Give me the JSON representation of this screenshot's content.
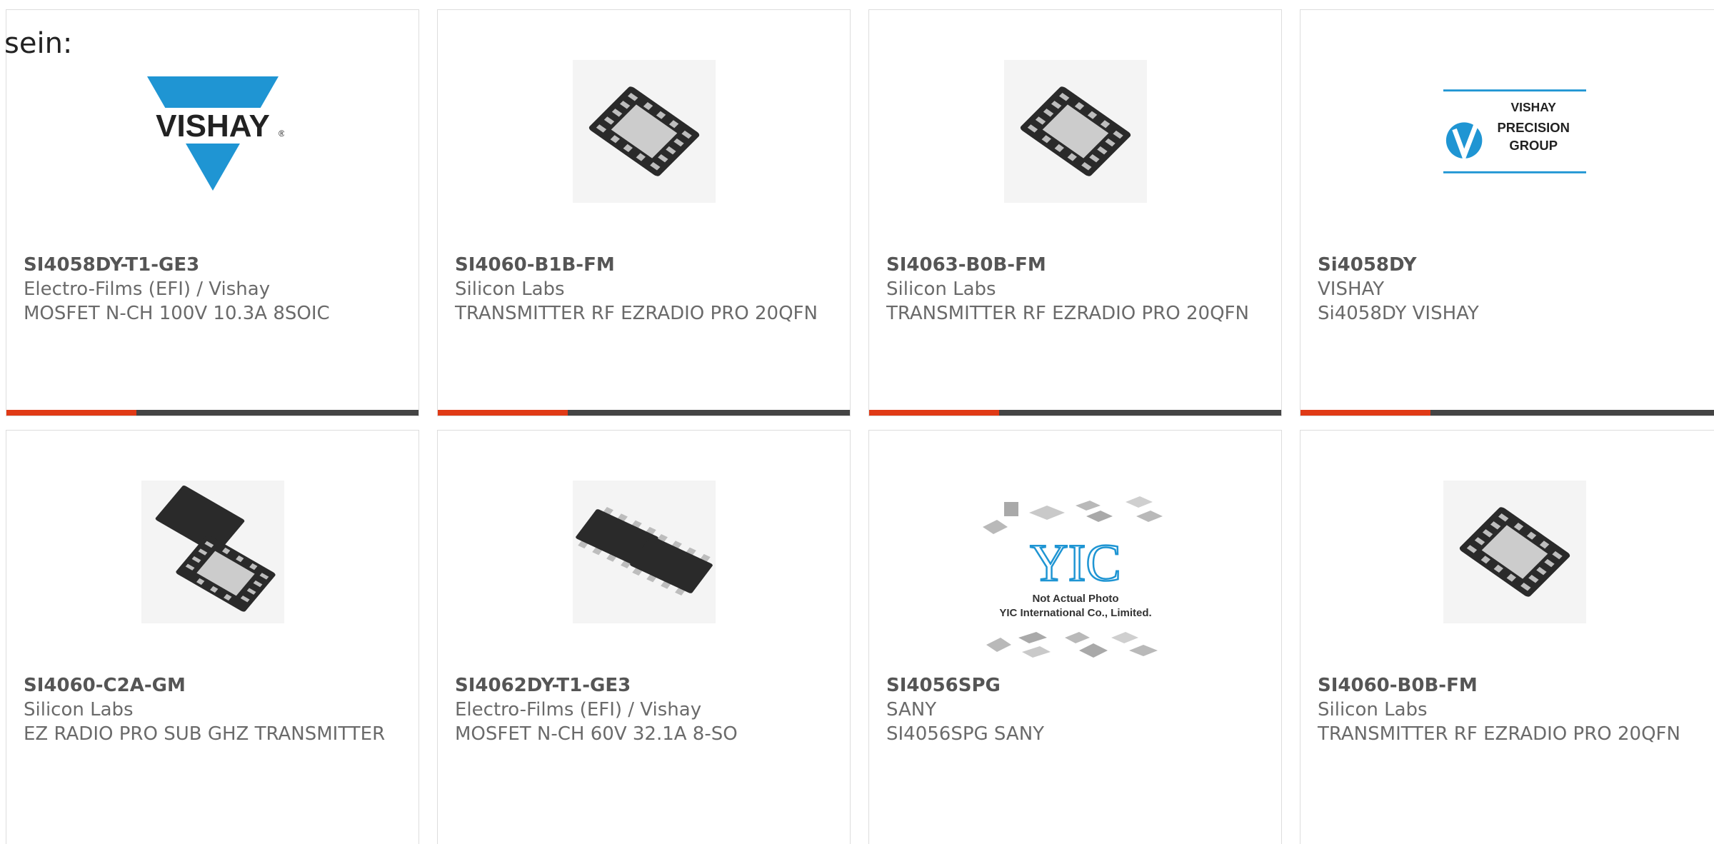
{
  "intro_text": "sein:",
  "products": [
    {
      "part_number": "SI4058DY-T1-GE3",
      "manufacturer": "Electro-Films (EFI) / Vishay",
      "description": "MOSFET N-CH 100V 10.3A 8SOIC",
      "image": "vishay-logo"
    },
    {
      "part_number": "SI4060-B1B-FM",
      "manufacturer": "Silicon Labs",
      "description": "TRANSMITTER RF EZRADIO PRO 20QFN",
      "image": "qfn-chip"
    },
    {
      "part_number": "SI4063-B0B-FM",
      "manufacturer": "Silicon Labs",
      "description": "TRANSMITTER RF EZRADIO PRO 20QFN",
      "image": "qfn-chip"
    },
    {
      "part_number": "Si4058DY",
      "manufacturer": "VISHAY",
      "description": "Si4058DY VISHAY",
      "image": "vishay-precision-group-logo",
      "logo_text": [
        "VISHAY",
        "PRECISION",
        "GROUP"
      ]
    },
    {
      "part_number": "SI4060-C2A-GM",
      "manufacturer": "Silicon Labs",
      "description": "EZ RADIO PRO SUB GHZ TRANSMITTER",
      "image": "qfn-chip-pair"
    },
    {
      "part_number": "SI4062DY-T1-GE3",
      "manufacturer": "Electro-Films (EFI) / Vishay",
      "description": "MOSFET N-CH 60V 32.1A 8-SO",
      "image": "soic-chip-pair"
    },
    {
      "part_number": "SI4056SPG",
      "manufacturer": "SANY",
      "description": "SI4056SPG SANY",
      "image": "yic-placeholder",
      "placeholder_text": [
        "YIC",
        "Not Actual Photo",
        "YIC International Co., Limited."
      ]
    },
    {
      "part_number": "SI4060-B0B-FM",
      "manufacturer": "Silicon Labs",
      "description": "TRANSMITTER RF EZRADIO PRO 20QFN",
      "image": "qfn-chip"
    }
  ],
  "colors": {
    "accent": "#e03a16",
    "bar": "#444444",
    "border": "#dddddd",
    "text": "#666666"
  }
}
